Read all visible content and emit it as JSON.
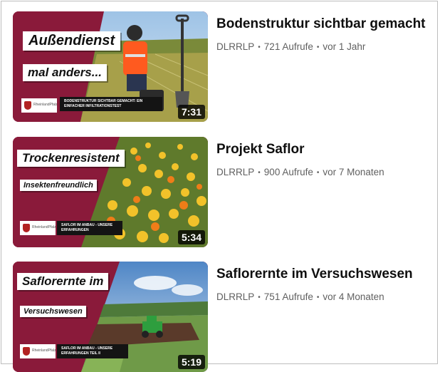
{
  "videos": [
    {
      "title": "Bodenstruktur sichtbar gemacht",
      "channel": "DLRRLP",
      "views": "721 Aufrufe",
      "age": "vor 1 Jahr",
      "duration": "7:31",
      "thumb_tag_1": "Außendienst",
      "thumb_tag_2": "mal anders...",
      "thumb_banner": "BODENSTRUKTUR SICHTBAR GEMACHT: EIN EINFACHER INFILTRATIONSTEST",
      "thumb_logo_text": "RheinlandPfalz"
    },
    {
      "title": "Projekt Saflor",
      "channel": "DLRRLP",
      "views": "900 Aufrufe",
      "age": "vor 7 Monaten",
      "duration": "5:34",
      "thumb_tag_1": "Trockenresistent",
      "thumb_tag_2": "Insektenfreundlich",
      "thumb_banner": "SAFLOR IM ANBAU - UNSERE ERFAHRUNGEN",
      "thumb_logo_text": "RheinlandPfalz"
    },
    {
      "title": "Saflorernte im Versuchswesen",
      "channel": "DLRRLP",
      "views": "751 Aufrufe",
      "age": "vor 4 Monaten",
      "duration": "5:19",
      "thumb_tag_1": "Saflorernte im",
      "thumb_tag_2": "Versuchswesen",
      "thumb_banner": "SAFLOR IM ANBAU - UNSERE ERFAHRUNGEN TEIL II",
      "thumb_logo_text": "RheinlandPfalz"
    }
  ],
  "separator": "•",
  "colors": {
    "brand_maroon": "#8a1a3a",
    "title_text": "#0f0f0f",
    "meta_text": "#606060"
  }
}
